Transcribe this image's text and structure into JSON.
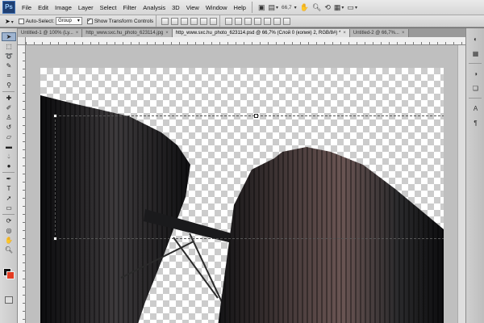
{
  "app": {
    "logo": "Ps"
  },
  "menu": [
    "File",
    "Edit",
    "Image",
    "Layer",
    "Select",
    "Filter",
    "Analysis",
    "3D",
    "View",
    "Window",
    "Help"
  ],
  "menubar_tools": {
    "zoom_level": "66,7",
    "icons": [
      "hand-icon",
      "zoom-icon",
      "rotate-view-icon",
      "screen-mode-icon"
    ]
  },
  "options": {
    "auto_select_label": "Auto-Select:",
    "auto_select_value": "Group",
    "show_transform_label": "Show Transform Controls",
    "show_transform_checked": true,
    "auto_select_checked": false
  },
  "tabs": [
    {
      "label": "Untitled-1 @ 100% (Ly...",
      "active": false
    },
    {
      "label": "http_www.sxc.hu_photo_623114.jpg",
      "active": false
    },
    {
      "label": "http_www.sxc.hu_photo_623114.psd @ 66,7% (Слой 0 (копия) 2, RGB/8#) *",
      "active": true
    },
    {
      "label": "Untitled-2 @ 66,7%...",
      "active": false
    }
  ],
  "toolbox": {
    "icons": [
      "move-tool-icon",
      "marquee-tool-icon",
      "lasso-tool-icon",
      "quick-select-tool-icon",
      "crop-tool-icon",
      "eyedropper-tool-icon",
      "healing-brush-icon",
      "brush-tool-icon",
      "clone-stamp-icon",
      "history-brush-icon",
      "eraser-tool-icon",
      "gradient-tool-icon",
      "blur-tool-icon",
      "dodge-tool-icon",
      "pen-tool-icon",
      "type-tool-icon",
      "path-select-icon",
      "shape-tool-icon",
      "3d-rotate-icon",
      "3d-camera-icon",
      "hand-tool-icon",
      "zoom-tool-icon"
    ],
    "foreground_color": "#111111",
    "background_color": "#e33c22"
  },
  "panel_dock": {
    "icons": [
      "color-panel-icon",
      "swatches-panel-icon",
      "adjustments-panel-icon",
      "layers-panel-icon",
      "character-panel-icon",
      "paragraph-panel-icon"
    ]
  }
}
